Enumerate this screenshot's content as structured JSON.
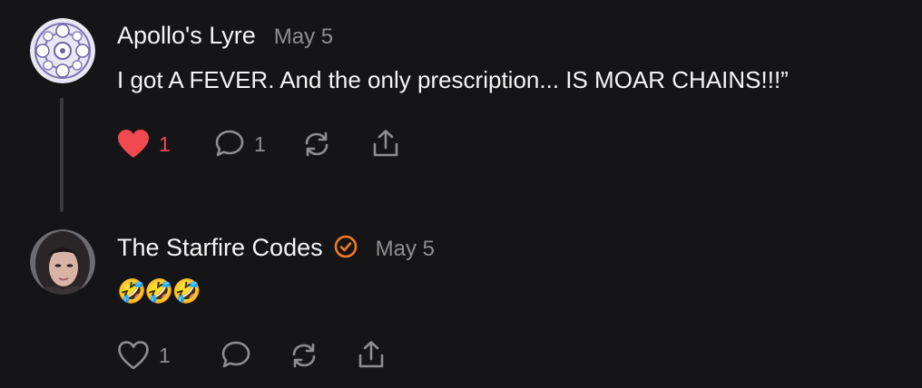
{
  "comments": [
    {
      "author": "Apollo's Lyre",
      "date": "May 5",
      "text": "I got A FEVER. And the only prescription... IS MOAR CHAINS!!!”",
      "verified": false,
      "liked": true,
      "like_count": "1",
      "reply_count": "1",
      "icons": {
        "like": "heart-filled-icon",
        "reply": "speech-bubble-icon",
        "restack": "restack-arrows-icon",
        "share": "share-upload-icon"
      }
    },
    {
      "author": "The Starfire Codes",
      "date": "May 5",
      "text": "🤣🤣🤣",
      "verified": true,
      "liked": false,
      "like_count": "1",
      "reply_count": "",
      "icons": {
        "like": "heart-outline-icon",
        "reply": "speech-bubble-icon",
        "restack": "restack-arrows-icon",
        "share": "share-upload-icon"
      }
    }
  ],
  "colors": {
    "background": "#151517",
    "text": "#f4f4f4",
    "muted": "#8e8e93",
    "like_active": "#f0494f",
    "verified_badge": "#f07a24"
  }
}
